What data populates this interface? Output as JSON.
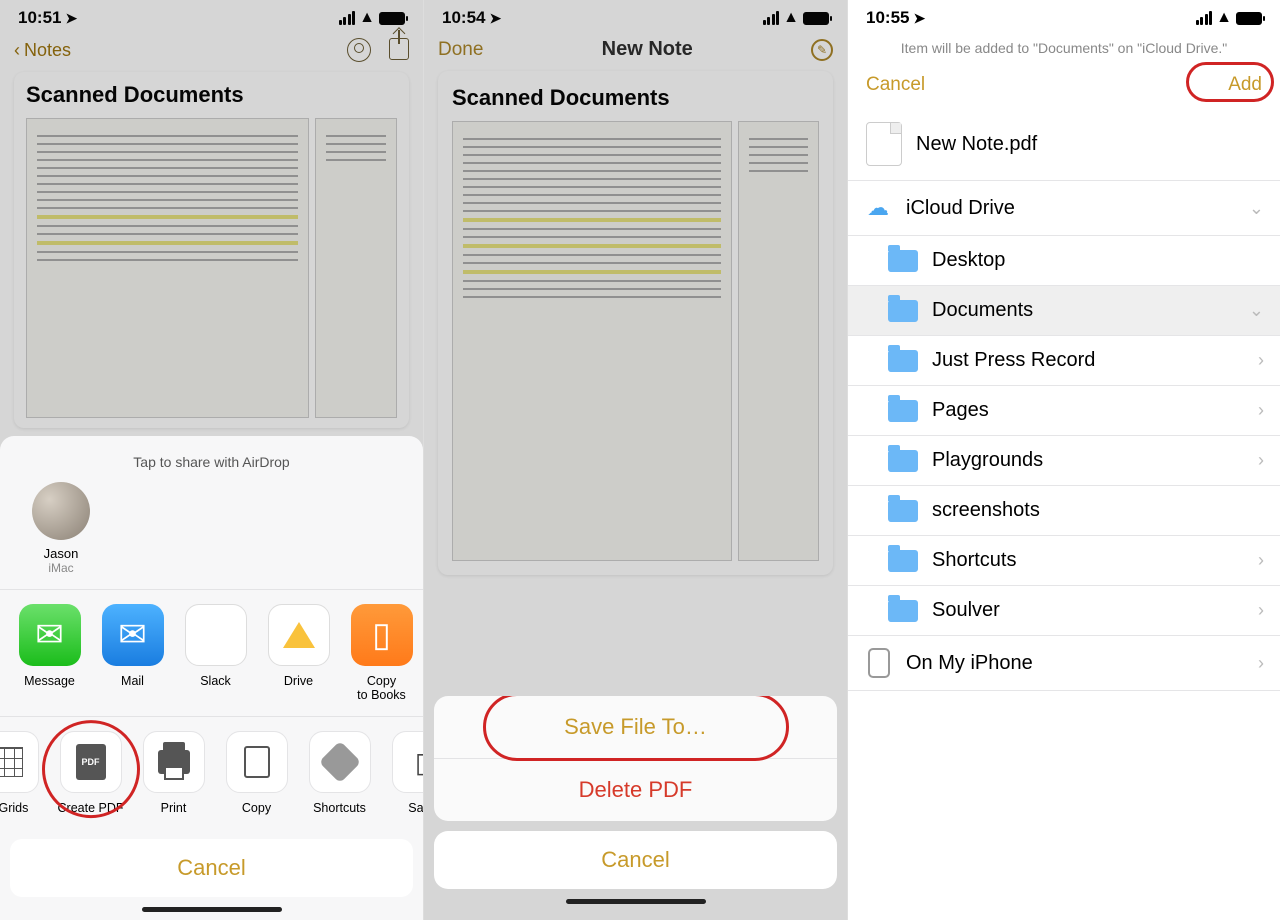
{
  "pane1": {
    "time": "10:51",
    "back_label": "Notes",
    "note_heading": "Scanned Documents",
    "sheet_title": "Tap to share with AirDrop",
    "airdrop": {
      "name": "Jason",
      "device": "iMac"
    },
    "apps": [
      {
        "label": "Message"
      },
      {
        "label": "Mail"
      },
      {
        "label": "Slack"
      },
      {
        "label": "Drive"
      },
      {
        "label": "Copy\nto Books"
      }
    ],
    "actions": [
      {
        "label": "& Grids"
      },
      {
        "label": "Create PDF"
      },
      {
        "label": "Print"
      },
      {
        "label": "Copy"
      },
      {
        "label": "Shortcuts"
      },
      {
        "label": "Save"
      }
    ],
    "cancel": "Cancel"
  },
  "pane2": {
    "time": "10:54",
    "done": "Done",
    "title": "New Note",
    "note_heading": "Scanned Documents",
    "save": "Save File To…",
    "delete": "Delete PDF",
    "cancel": "Cancel"
  },
  "pane3": {
    "time": "10:55",
    "subtitle": "Item will be added to \"Documents\" on \"iCloud Drive.\"",
    "cancel": "Cancel",
    "add": "Add",
    "filename": "New Note.pdf",
    "icloud_label": "iCloud Drive",
    "folders": [
      "Desktop",
      "Documents",
      "Just Press Record",
      "Pages",
      "Playgrounds",
      "screenshots",
      "Shortcuts",
      "Soulver"
    ],
    "local_label": "On My iPhone"
  }
}
